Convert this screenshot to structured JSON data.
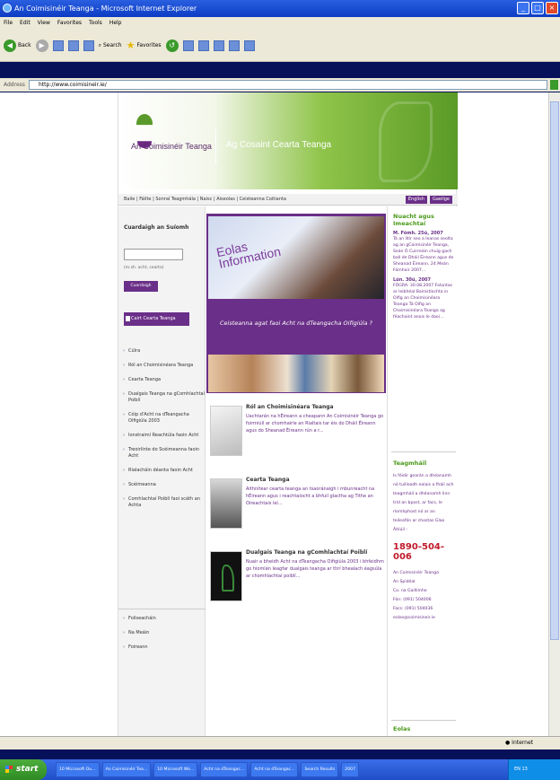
{
  "window": {
    "title": "An Coimisinéir Teanga - Microsoft Internet Explorer",
    "controls": [
      "_",
      "□",
      "×"
    ]
  },
  "menu": [
    "File",
    "Edit",
    "View",
    "Favorites",
    "Tools",
    "Help"
  ],
  "toolbar": {
    "back": "Back",
    "search": "Search",
    "favorites": "Favorites"
  },
  "address": {
    "label": "Address",
    "url": "http://www.coimisineir.ie/"
  },
  "site": {
    "org_name": "An Coimisinéir Teanga",
    "tagline": "Ag Cosaint Cearta Teanga",
    "nav": "Baile | Fáilte | Sonraí Teagmhála | Naisc | Aiseolas | Ceisteanna Coitianta",
    "lang_english": "English",
    "lang_gaeilge": "Gaeilge",
    "search_title": "Cuardaigh an Suíomh",
    "search_hint": "(m.sh. acht, cearta)",
    "search_button": "Cuardaigh",
    "feature_button": "Cairt Cearta Teanga",
    "left_nav": [
      "Cúlra",
      "Ról an Choimisinéara Teanga",
      "Cearta Teanga",
      "Dualgais Teanga na gComhlachtaí Poiblí",
      "Cóip d'Acht na dTeangacha Oifigiúla 2003",
      "Ionstraimí Reachtúla faoin Acht",
      "Treoirlínte do Scéimeanna faoin Acht",
      "Rialacháin déanta faoin Acht",
      "Scéimeanna",
      "Comhlachtaí Poiblí faoi scáth an Achta"
    ],
    "left_nav2": [
      "Foilseacháin",
      "Na Meáin",
      "Foireann"
    ],
    "hero_eolas": "Eolas",
    "hero_info": "Information",
    "hero_question": "Ceisteanna agat faoi Acht na dTeangacha Oifigiúla ?",
    "articles": [
      {
        "title": "Ról an Choimisinéara Teanga",
        "text": "Uachtarán na hÉireann a cheapann An Coimisinéir Teanga go foirmiúil ar chomhairle an Rialtais tar éis do Dháil Éireann agus do Sheanad Éireann rún a r..."
      },
      {
        "title": "Cearta Teanga",
        "text": "Aithnítear cearta teanga an tsaoránaigh i mbunreacht na hÉireann agus i reachtaíocht a bhfuil glactha ag Tithe an Oireachtais leí..."
      },
      {
        "title": "Dualgais Teanga na gComhlachtaí Poiblí",
        "text": "Nuair a bheidh Acht na dTeangacha Oifigiúla 2003 i bhfeidhm go hiomlán leagfar dualgais teanga ar thrí bhealach éagsúla ar chomhlachtaí poiblí..."
      }
    ],
    "news_title": "Nuacht agus Imeachtaí",
    "news": [
      {
        "date": "M. Fómh. 25ú, 2007",
        "text": "Tá an litir seo a leanas seolta ag an gCoimisinéir Teanga, Seán Ó Cuirreáin chuig gach ball de Dháil Éireann agus de Sheanad Éireann. 24 Meán Fómhair 2007..."
      },
      {
        "date": "Lún. 30ú, 2007",
        "text": "FÓGRA: 30.08.2007 Folúntas ar leibhéal Bainistíochta in Oifig an Choimisinéara Teanga Tá Oifig an Choimisinéara Teanga ag féachaint anois le daoi..."
      }
    ],
    "contact_title": "Teagmháil",
    "contact_text": "Is féidir gearán a dhéanamh nó tuilleadh eolais a fháil ach teagmháil a dhéanamh linn tríd an bpost, ar facs, le ríomhphost nó ar an teileafón ar chostas Glao Áitiúil :",
    "phone": "1890-504-006",
    "address_lines": [
      "An Coimisinéir Teanga",
      "An Spidéal",
      "Co. na Gaillimhe",
      "Fón: (091) 504006",
      "Facs: (091) 504036",
      "eolas@coimisineir.ie"
    ],
    "eolas_title": "Eolas"
  },
  "status": {
    "text": "",
    "zone": "Internet"
  },
  "taskbar": {
    "start": "start",
    "tasks": [
      "10 Microsoft Ou...",
      "An Coimisinéir Tea...",
      "10 Microsoft Wo...",
      "Acht na dTeangac...",
      "Acht na dTeangac...",
      "Search Results",
      "2007"
    ],
    "tray": "EN 13"
  }
}
